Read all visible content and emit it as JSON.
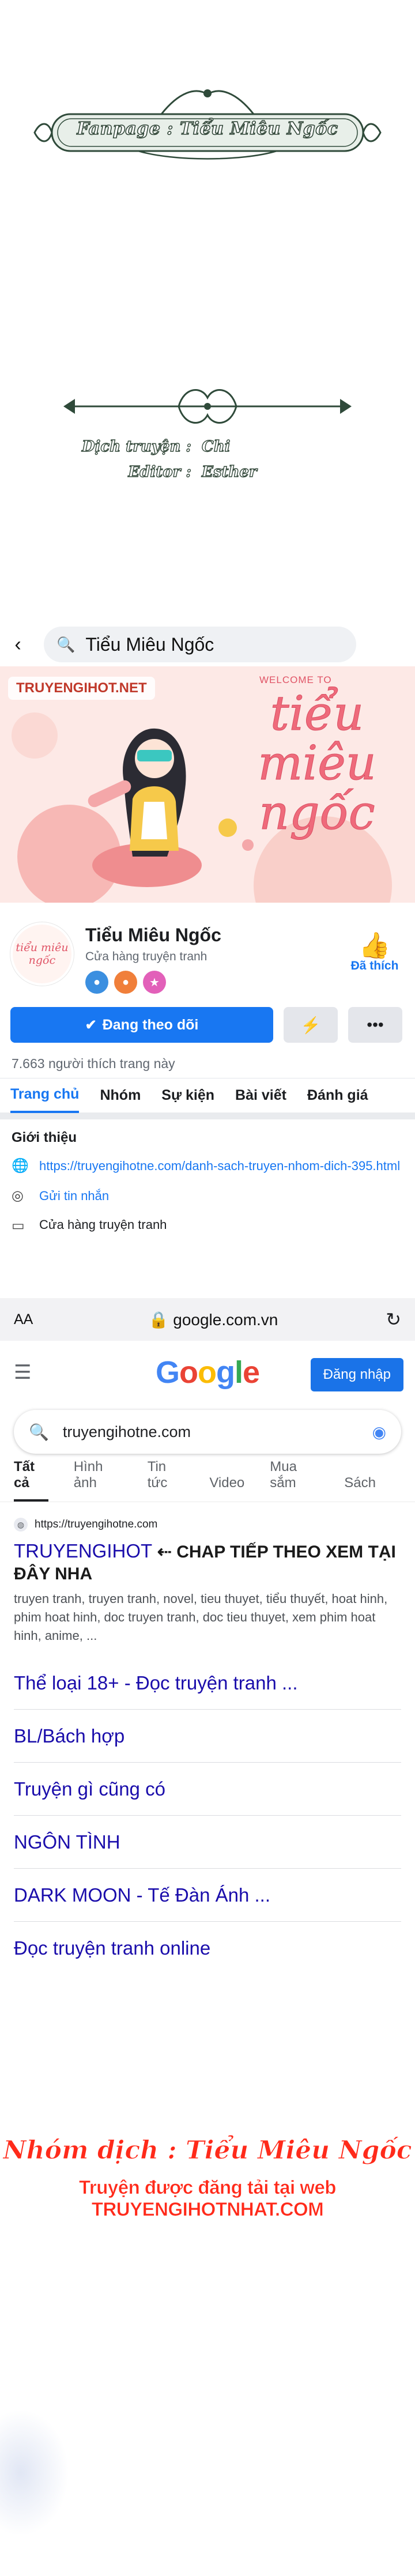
{
  "credits": {
    "fanpage": "Fanpage : Tiểu Miêu Ngốc",
    "translator_label": "Dịch truyện :",
    "translator_value": "Chi",
    "editor_label": "Editor :",
    "editor_value": "Esther"
  },
  "facebook": {
    "search_text": "Tiểu Miêu Ngốc",
    "cover_watermark": "TRUYENGIHOT.NET",
    "cover_welcome": "WELCOME TO",
    "cover_brand": "tiểu miêu ngốc",
    "page_name": "Tiểu Miêu Ngốc",
    "category": "Cửa hàng truyện tranh",
    "like_label": "Đã thích",
    "follow_label": "Đang theo dõi",
    "likes_count": "7.663 người thích trang này",
    "tabs": [
      "Trang chủ",
      "Nhóm",
      "Sự kiện",
      "Bài viết",
      "Đánh giá"
    ],
    "intro_title": "Giới thiệu",
    "intro_link": "https://truyengihotne.com/danh-sach-truyen-nhom-dich-395.html",
    "intro_message": "Gửi tin nhắn",
    "intro_store": "Cửa hàng truyện tranh",
    "icons": [
      "back-arrow-icon",
      "search-icon",
      "thumbs-up-icon",
      "messenger-icon",
      "more-icon",
      "globe-icon",
      "message-icon",
      "store-icon"
    ]
  },
  "safari": {
    "aa": "AA",
    "url": "google.com.vn"
  },
  "google": {
    "logo": [
      "G",
      "o",
      "o",
      "g",
      "l",
      "e"
    ],
    "signin": "Đăng nhập",
    "query": "truyengihotne.com",
    "tabs": [
      "Tất cả",
      "Hình ảnh",
      "Tin tức",
      "Video",
      "Mua sắm",
      "Sách"
    ],
    "result_url": "https://truyengihotne.com",
    "result_title_main": "TRUYENGIHOT",
    "result_title_promo": "⇠ CHAP TIẾP THEO XEM TẠI ĐÂY NHA",
    "result_snippet": "truyen tranh, truyen tranh, novel, tieu thuyet, tiểu thuyết, hoat hinh, phim hoat hinh, doc truyen tranh, doc tieu thuyet, xem phim hoat hinh, anime, ...",
    "sitelinks": [
      "Thể loại 18+ - Đọc truyện tranh ...",
      "BL/Bách hợp",
      "Truyện gì cũng có",
      "NGÔN TÌNH",
      "DARK MOON - Tế Đàn Ánh ...",
      "Đọc truyện tranh online"
    ]
  },
  "footer": {
    "line1": "Nhóm dịch : Tiểu Miêu Ngốc",
    "line2": "Truyện được đăng tải tại web TRUYENGIHOTNHAT.COM"
  }
}
